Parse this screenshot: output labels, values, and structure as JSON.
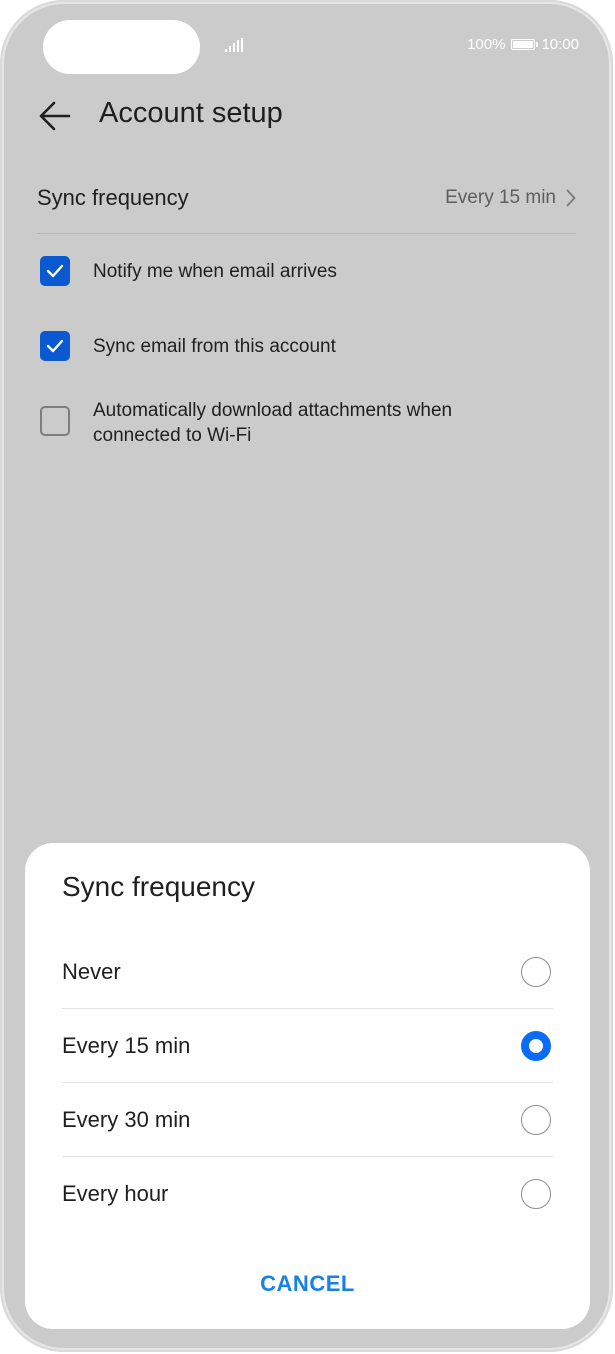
{
  "status_bar": {
    "battery": "100%",
    "time": "10:00"
  },
  "header": {
    "title": "Account setup"
  },
  "settings": {
    "sync_frequency_label": "Sync frequency",
    "sync_frequency_value": "Every 15 min",
    "options": [
      {
        "label": "Notify me when email arrives",
        "checked": true
      },
      {
        "label": "Sync email from this account",
        "checked": true
      },
      {
        "label": "Automatically download attachments when connected to Wi-Fi",
        "checked": false
      }
    ]
  },
  "dialog": {
    "title": "Sync frequency",
    "choices": [
      {
        "label": "Never",
        "selected": false
      },
      {
        "label": "Every 15 min",
        "selected": true
      },
      {
        "label": "Every 30 min",
        "selected": false
      },
      {
        "label": "Every hour",
        "selected": false
      }
    ],
    "cancel_label": "CANCEL"
  },
  "colors": {
    "accent": "#0a6cf2",
    "checkbox_on": "#0a59d0",
    "cancel_text": "#1682e6",
    "scrim": "#cbcbcb"
  }
}
